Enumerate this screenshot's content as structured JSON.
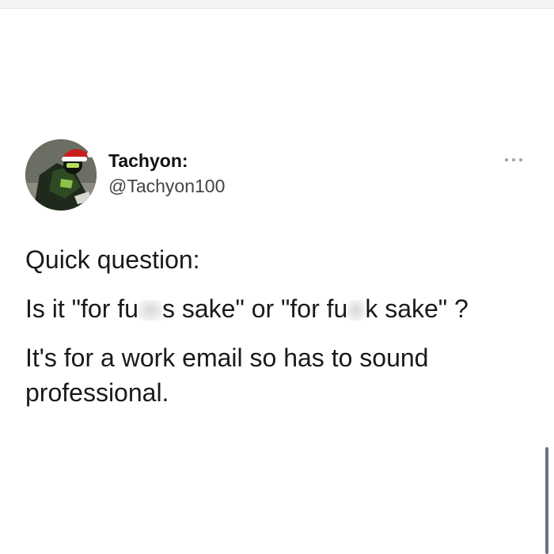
{
  "tweet": {
    "author": {
      "display_name": "Tachyon:",
      "handle": "@Tachyon100",
      "avatar_icon": "avatar-santa-hat-rider"
    },
    "more_icon": "more-options-icon",
    "lines": {
      "line1": "Quick question:",
      "line2_a": "Is it \"for fu",
      "line2_b": "s sake\" or \"for fu",
      "line2_c": "k sake\" ?",
      "line3": "It's for a work email so has to sound professional."
    }
  },
  "colors": {
    "background": "#ffffff",
    "text": "#1a1a1a",
    "handle": "#444444",
    "accent_hat": "#c81e1e"
  }
}
